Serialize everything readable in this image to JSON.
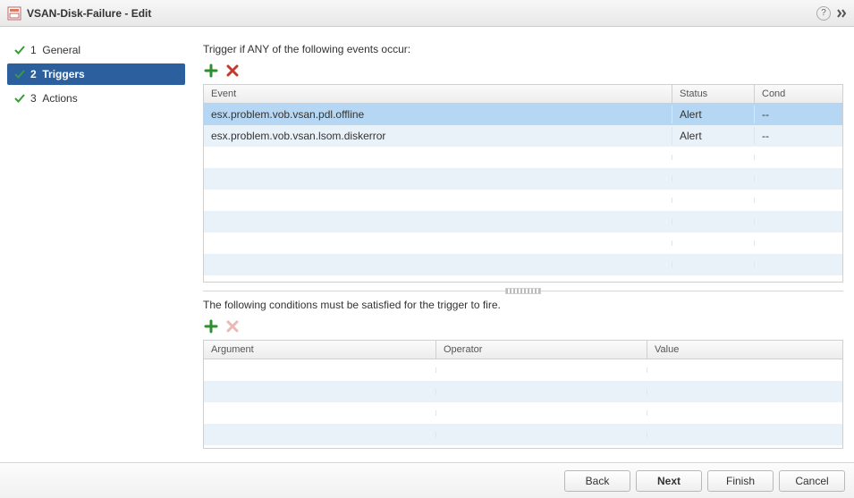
{
  "window": {
    "title": "VSAN-Disk-Failure - Edit"
  },
  "wizard": {
    "steps": [
      {
        "num": "1",
        "label": "General",
        "state": "done"
      },
      {
        "num": "2",
        "label": "Triggers",
        "state": "current"
      },
      {
        "num": "3",
        "label": "Actions",
        "state": "done"
      }
    ]
  },
  "events_section": {
    "label": "Trigger if ANY of the following events occur:",
    "columns": {
      "event": "Event",
      "status": "Status",
      "cond": "Cond"
    },
    "rows": [
      {
        "event": "esx.problem.vob.vsan.pdl.offline",
        "status": "Alert",
        "cond": "--",
        "selected": true
      },
      {
        "event": "esx.problem.vob.vsan.lsom.diskerror",
        "status": "Alert",
        "cond": "--",
        "selected": false
      }
    ]
  },
  "conditions_section": {
    "label": "The following conditions must be satisfied for the trigger to fire.",
    "columns": {
      "argument": "Argument",
      "operator": "Operator",
      "value": "Value"
    },
    "rows": []
  },
  "footer": {
    "back": "Back",
    "next": "Next",
    "finish": "Finish",
    "cancel": "Cancel"
  }
}
